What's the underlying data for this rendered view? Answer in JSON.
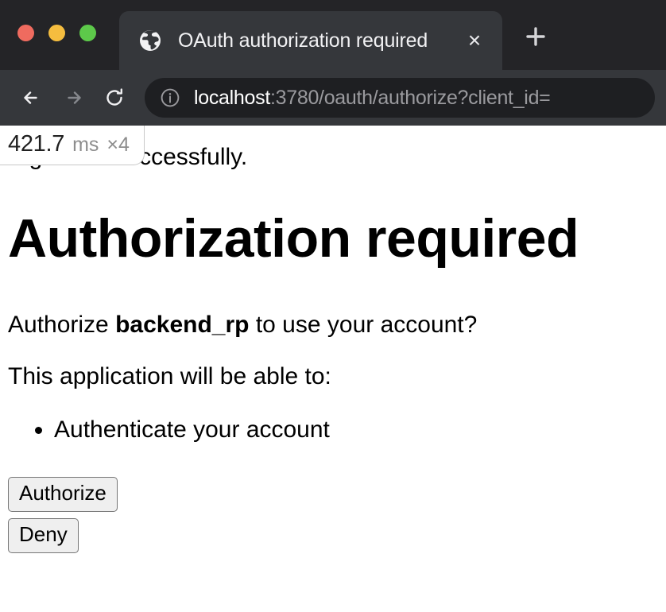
{
  "window": {
    "traffic_lights": [
      {
        "name": "close",
        "color": "#ef6b5f"
      },
      {
        "name": "minimize",
        "color": "#f5bd3f"
      },
      {
        "name": "zoom",
        "color": "#5dc94a"
      }
    ]
  },
  "tab_strip": {
    "active_tab": {
      "title": "OAuth authorization required",
      "favicon": "globe-icon",
      "close_label": "×"
    },
    "new_tab_label": "+"
  },
  "toolbar": {
    "back_label": "←",
    "forward_label": "→",
    "reload_label": "↻",
    "site_info_icon": "info-circle-icon",
    "url": {
      "host": "localhost",
      "rest": ":3780/oauth/authorize?client_id=",
      "full": "localhost:3780/oauth/authorize?client_id="
    }
  },
  "perf_overlay": {
    "value": "421.7",
    "unit": "ms",
    "count": "×4"
  },
  "page": {
    "flash_message": "Signed in successfully.",
    "title": "Authorization required",
    "prompt_prefix": "Authorize ",
    "client_name": "backend_rp",
    "prompt_suffix": " to use your account?",
    "scopes_intro": "This application will be able to:",
    "scopes": [
      "Authenticate your account"
    ],
    "buttons": {
      "authorize": "Authorize",
      "deny": "Deny"
    }
  },
  "colors": {
    "chrome_dark": "#242427",
    "toolbar": "#35373b",
    "tab_active": "#35373b",
    "url_pill": "#1e1f22",
    "page_bg": "#ffffff",
    "text": "#000000",
    "button_face": "#efefef",
    "button_border": "#767676"
  }
}
